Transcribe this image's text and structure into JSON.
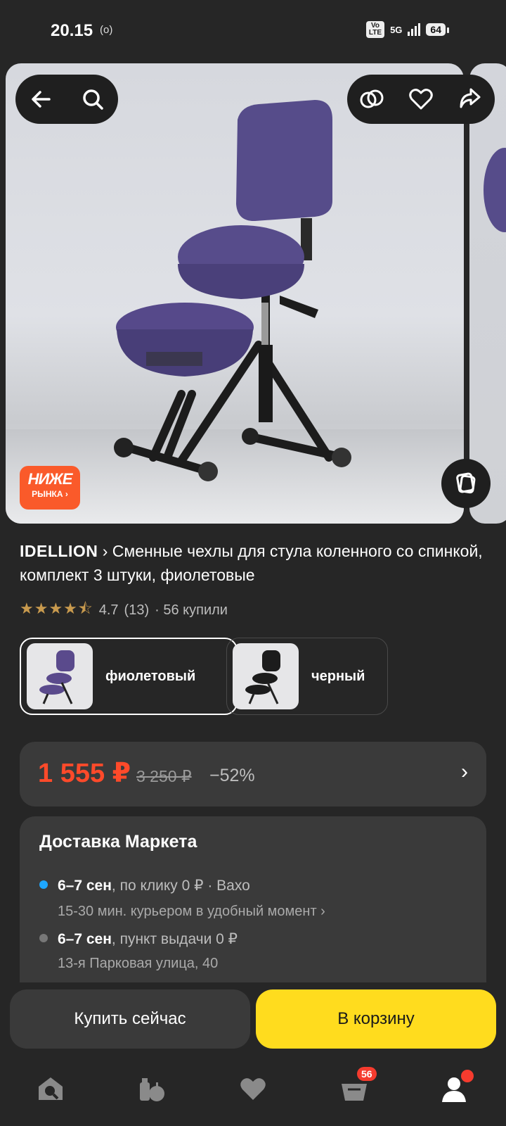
{
  "status_bar": {
    "time": "20.15",
    "cast_icon": "(o)",
    "volte": "Vo\nLTE",
    "network": "5G",
    "battery": "64"
  },
  "gallery": {
    "badge_line1": "НИЖЕ",
    "badge_line2": "РЫНКА ›",
    "icons": [
      "back-icon",
      "search-icon",
      "compare-icon",
      "heart-icon",
      "share-icon",
      "3d-view-icon"
    ]
  },
  "product": {
    "brand": "IDELLION",
    "brand_chevron": "›",
    "title": "Сменные чехлы для стула коленного со спинкой, комплект 3 штуки, фиолетовые",
    "stars": "★★★★⯪",
    "rating": "4.7",
    "reviews": "(13)",
    "bought": "· 56 купили"
  },
  "variants": [
    {
      "label": "фиолетовый",
      "color": "#5a4a8c",
      "selected": true
    },
    {
      "label": "черный",
      "color": "#1c1c1c",
      "selected": false
    }
  ],
  "price": {
    "current": "1 555 ₽",
    "old": "3 250 ₽",
    "discount": "−52%",
    "chevron": "›"
  },
  "delivery": {
    "title": "Доставка Маркета",
    "option1": {
      "date": "6–7 сен",
      "rest": ", по клику 0 ₽ · Вахо",
      "sub": "15-30 мин. курьером в удобный момент ›",
      "dot_color": "#1ea7ff"
    },
    "option2": {
      "date": "6–7 сен",
      "rest": ", пункт выдачи 0 ₽",
      "sub": "13-я Парковая улица, 40",
      "dot_color": "#777777"
    }
  },
  "actions": {
    "buy_now": "Купить сейчас",
    "add_to_cart": "В корзину"
  },
  "nav": {
    "cart_badge": "56",
    "items": [
      "home-icon",
      "catalog-icon",
      "favorites-icon",
      "cart-icon",
      "profile-icon"
    ]
  }
}
